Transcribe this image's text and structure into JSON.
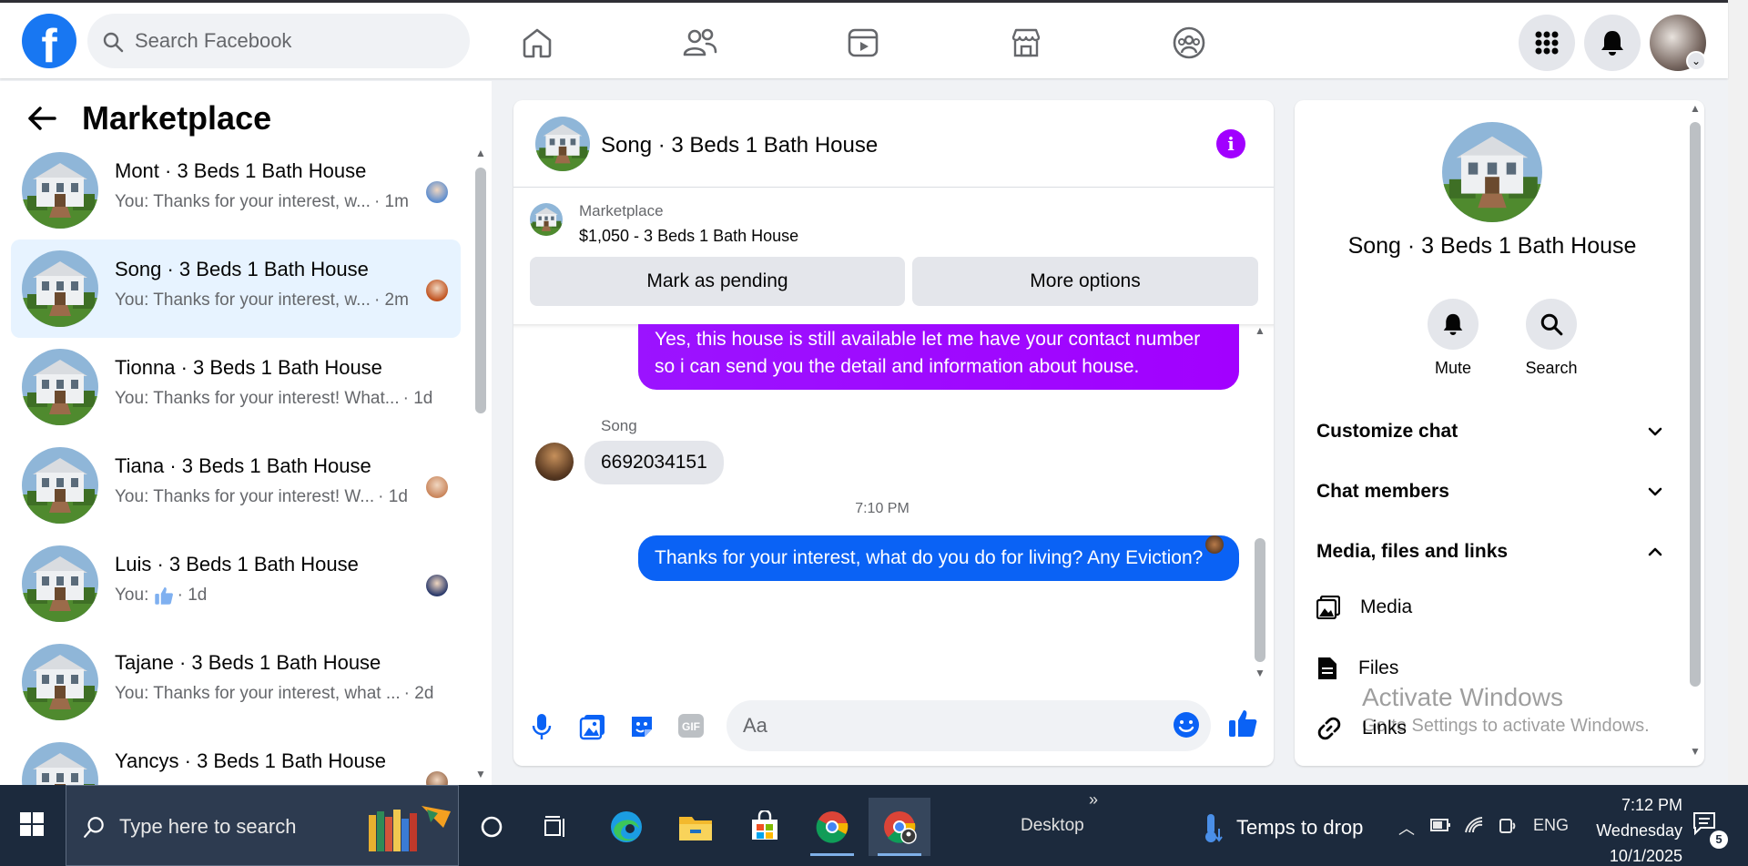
{
  "topbar": {
    "search_placeholder": "Search Facebook",
    "nav_icons": [
      "home-icon",
      "friends-icon",
      "watch-icon",
      "marketplace-icon",
      "groups-icon"
    ],
    "right_icons": [
      "menu-grid-icon",
      "notifications-bell-icon",
      "account-avatar"
    ]
  },
  "left": {
    "title": "Marketplace",
    "conversations": [
      {
        "title": "Mont · 3 Beds 1 Bath House",
        "preview": "You: Thanks for your interest, w...",
        "time": "· 1m",
        "active": false
      },
      {
        "title": "Song · 3 Beds 1 Bath House",
        "preview": "You: Thanks for your interest, w...",
        "time": "· 2m",
        "active": true
      },
      {
        "title": "Tionna · 3 Beds 1 Bath House",
        "preview": "You: Thanks for your interest! What...",
        "time": "· 1d",
        "active": false
      },
      {
        "title": "Tiana · 3 Beds 1 Bath House",
        "preview": "You: Thanks for your interest! W...",
        "time": "· 1d",
        "active": false
      },
      {
        "title": "Luis · 3 Beds 1 Bath House",
        "preview": "You: ",
        "time": "· 1d",
        "active": false
      },
      {
        "title": "Tajane · 3 Beds 1 Bath House",
        "preview": "You: Thanks for your interest, what ...",
        "time": "· 2d",
        "active": false
      },
      {
        "title": "Yancys · 3 Beds 1 Bath House",
        "preview": "",
        "time": "",
        "active": false
      }
    ]
  },
  "chat": {
    "title": "Song · 3 Beds 1 Bath House",
    "listing_label": "Marketplace",
    "listing_price": "$1,050 - 3 Beds 1 Bath House",
    "mark_pending": "Mark as pending",
    "more_options": "More options",
    "messages": {
      "out1": "Yes, this house is still available let me have your contact number so i can send you the detail and information about house.",
      "sender": "Song",
      "in1": "6692034151",
      "timestamp": "7:10 PM",
      "out2": "Thanks for your interest, what do you do for living? Any Eviction?"
    },
    "composer_placeholder": "Aa"
  },
  "info": {
    "name": "Song · 3 Beds 1 Bath House",
    "mute": "Mute",
    "search": "Search",
    "customize": "Customize chat",
    "members": "Chat members",
    "media_files_links": "Media, files and links",
    "media": "Media",
    "files": "Files",
    "links": "Links"
  },
  "watermark": {
    "line1": "Activate Windows",
    "line2": "Go to Settings to activate Windows."
  },
  "taskbar": {
    "search_placeholder": "Type here to search",
    "desktop": "Desktop",
    "weather": "Temps to drop",
    "lang": "ENG",
    "time": "7:12 PM",
    "day": "Wednesday",
    "date": "10/1/2025",
    "notif_count": "5"
  },
  "colors": {
    "facebook_blue": "#1877f2",
    "message_purple": "#a200ff",
    "message_blue": "#0a62f5",
    "active_row": "#e7f3ff",
    "taskbar": "#1c2a3d"
  }
}
